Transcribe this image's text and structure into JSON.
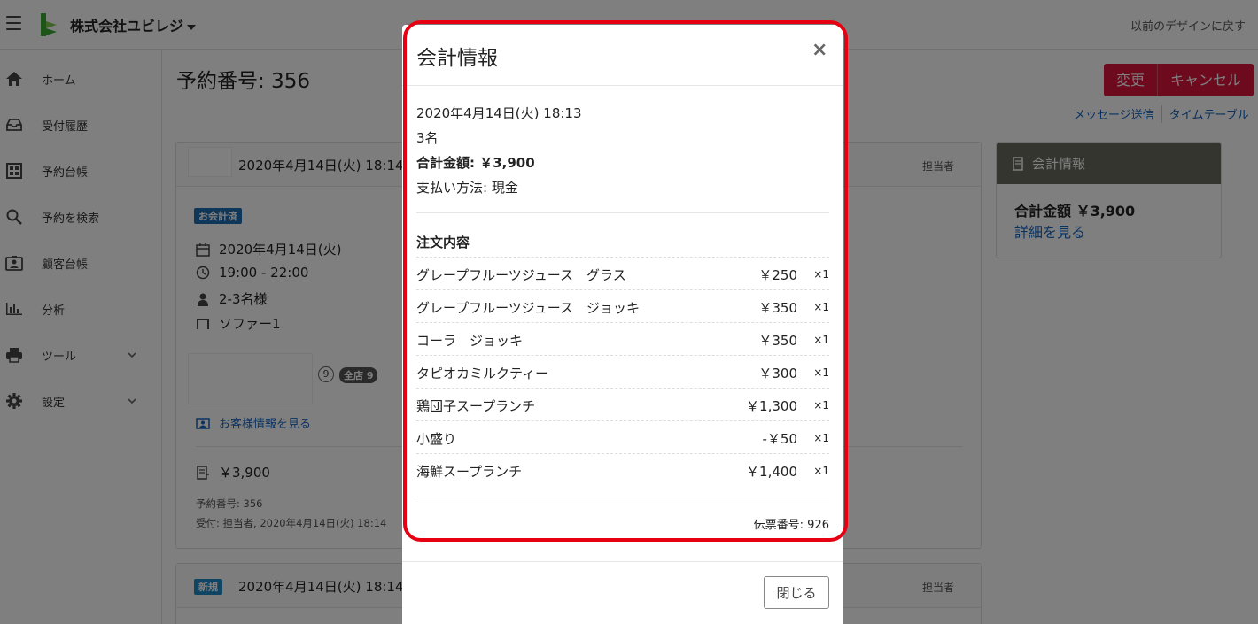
{
  "topbar": {
    "company": "株式会社ユビレジ",
    "revert_link": "以前のデザインに戻す"
  },
  "sidebar": {
    "items": [
      {
        "label": "ホーム",
        "icon": "home-icon"
      },
      {
        "label": "受付履歴",
        "icon": "inbox-icon"
      },
      {
        "label": "予約台帳",
        "icon": "grid-icon"
      },
      {
        "label": "予約を検索",
        "icon": "search-icon"
      },
      {
        "label": "顧客台帳",
        "icon": "customer-icon"
      },
      {
        "label": "分析",
        "icon": "chart-icon"
      },
      {
        "label": "ツール",
        "icon": "printer-icon"
      },
      {
        "label": "設定",
        "icon": "gear-icon"
      }
    ]
  },
  "main": {
    "title": "予約番号: 356",
    "buttons": {
      "change": "変更",
      "cancel": "キャンセル"
    },
    "links": {
      "message": "メッセージ送信",
      "timetable": "タイムテーブル"
    },
    "card1": {
      "datetime": "2020年4月14日(火) 18:14",
      "staff": "担当者",
      "badge": "お会計済",
      "date": "2020年4月14日(火)",
      "time": "19:00 - 22:00",
      "people": "2-3名様",
      "seat": "ソファー1",
      "visit_count": "9",
      "all_store": "全店 9",
      "customer_link": "お客様情報を見る",
      "amount": "￥3,900",
      "res_no": "予約番号: 356",
      "received": "受付: 担当者, 2020年4月14日(火) 18:14"
    },
    "card2": {
      "badge": "新規",
      "datetime": "2020年4月14日(火) 18:14",
      "staff": "担当者"
    },
    "side_card": {
      "title": "会計情報",
      "total": "合計金額 ￥3,900",
      "link": "詳細を見る"
    }
  },
  "modal": {
    "title": "会計情報",
    "close_symbol": "×",
    "datetime": "2020年4月14日(火) 18:13",
    "people": "3名",
    "total": "合計金額: ￥3,900",
    "payment": "支払い方法: 現金",
    "order_heading": "注文内容",
    "items": [
      {
        "name": "グレープフルーツジュース　グラス",
        "price": "￥250",
        "qty": "×1"
      },
      {
        "name": "グレープフルーツジュース　ジョッキ",
        "price": "￥350",
        "qty": "×1"
      },
      {
        "name": "コーラ　ジョッキ",
        "price": "￥350",
        "qty": "×1"
      },
      {
        "name": "タピオカミルクティー",
        "price": "￥300",
        "qty": "×1"
      },
      {
        "name": "鶏団子スープランチ",
        "price": "￥1,300",
        "qty": "×1"
      },
      {
        "name": "小盛り",
        "price": "-￥50",
        "qty": "×1"
      },
      {
        "name": "海鮮スープランチ",
        "price": "￥1,400",
        "qty": "×1"
      }
    ],
    "slip_number": "伝票番号: 926",
    "close_button": "閉じる"
  },
  "colors": {
    "brand_green": "#3aa935",
    "accent_red": "#dc143c",
    "highlight_red": "#e60012",
    "link_blue": "#1565c0",
    "badge_paid": "#1f6fb5",
    "badge_new": "#1e88c7"
  }
}
